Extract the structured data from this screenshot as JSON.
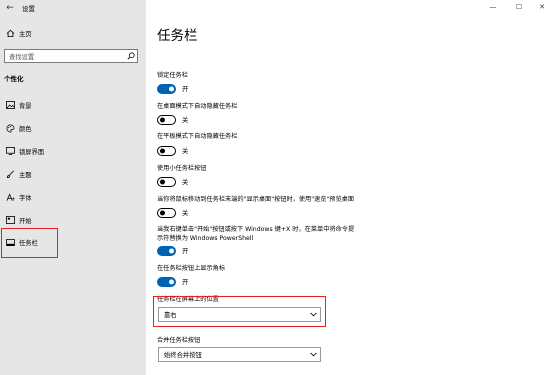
{
  "window": {
    "title": "设置",
    "controls": {
      "minimize": "—",
      "maximize": "☐",
      "close": "✕"
    }
  },
  "sidebar": {
    "home_label": "主页",
    "search_placeholder": "查找设置",
    "section_title": "个性化",
    "items": [
      {
        "label": "背景",
        "icon": "picture-icon"
      },
      {
        "label": "颜色",
        "icon": "palette-icon"
      },
      {
        "label": "锁屏界面",
        "icon": "lock-screen-icon"
      },
      {
        "label": "主题",
        "icon": "brush-icon"
      },
      {
        "label": "字体",
        "icon": "font-icon"
      },
      {
        "label": "开始",
        "icon": "start-icon"
      },
      {
        "label": "任务栏",
        "icon": "taskbar-icon",
        "selected": true
      }
    ]
  },
  "main": {
    "page_title": "任务栏",
    "settings": [
      {
        "label": "锁定任务栏",
        "state": "开",
        "on": true
      },
      {
        "label": "在桌面模式下自动隐藏任务栏",
        "state": "关",
        "on": false
      },
      {
        "label": "在平板模式下自动隐藏任务栏",
        "state": "关",
        "on": false
      },
      {
        "label": "使用小任务栏按钮",
        "state": "关",
        "on": false
      },
      {
        "label": "当你将鼠标移动到任务栏末端的\"显示桌面\"按钮时，使用\"速览\"预览桌面",
        "state": "关",
        "on": false
      },
      {
        "label_line1": "当我右键单击\"开始\"按钮或按下 Windows 键+X 时，在菜单中将命令提",
        "label_line2": "示符替换为 Windows PowerShell",
        "state": "开",
        "on": true
      },
      {
        "label": "在任务栏按钮上显示角标",
        "state": "开",
        "on": true
      }
    ],
    "position": {
      "label": "任务栏在屏幕上的位置",
      "value": "靠右"
    },
    "combine": {
      "label": "合并任务栏按钮",
      "value": "始终合并按钮"
    }
  },
  "colors": {
    "accent": "#0063b1",
    "highlight": "#e5202a",
    "sidebar_bg": "#e6e6e6"
  }
}
